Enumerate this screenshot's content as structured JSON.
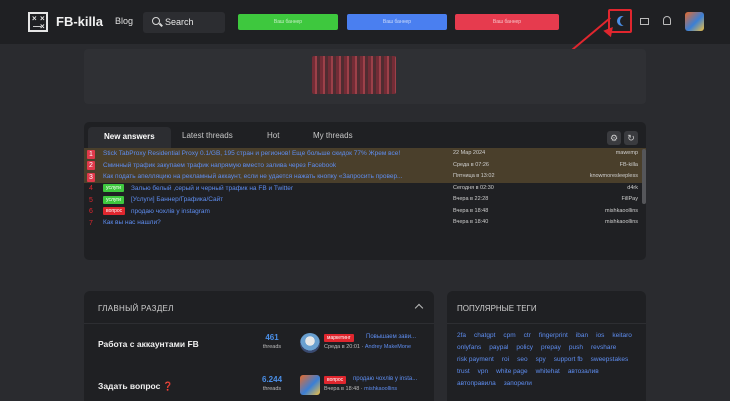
{
  "header": {
    "brand": "FB-killa",
    "nav_blog": "Blog",
    "search_label": "Search",
    "promos": [
      {
        "text": "Ваш баннер",
        "color": "#3ec83e"
      },
      {
        "text": "Ваш баннер",
        "color": "#4a7ff0"
      },
      {
        "text": "Ваш баннер",
        "color": "#e63b4e"
      }
    ],
    "icons": [
      "moon-icon",
      "mail-icon",
      "bell-icon"
    ]
  },
  "threads": {
    "tabs": [
      "New answers",
      "Latest threads",
      "Hot",
      "My threads"
    ],
    "rows": [
      {
        "num": "1",
        "tag": "",
        "title": "Stick TabProxy Residential Proxy 0.1/GB, 195 стран и регионов! Еще больше скидок 77% Жрем все!",
        "date": "22 Мар 2024",
        "author": "mawemp",
        "highlight": true
      },
      {
        "num": "2",
        "tag": "",
        "title": "Сминный трафик закупаем трафик напрямую вместо залива через Facebook",
        "date": "Среда в 07:26",
        "author": "FB-killa",
        "highlight": true
      },
      {
        "num": "3",
        "tag": "",
        "title": "Как подать апелляцию на рекламный аккаунт, если не удается нажать кнопку «Запросить провер...",
        "date": "Пятница в 13:02",
        "author": "knowmoresleepless",
        "highlight": true
      },
      {
        "num": "4",
        "tag": "услуги",
        "title": "Залью белый ,серый и черный трафик на FB и Twitter",
        "date": "Сегодня в 02:30",
        "author": "d4rk",
        "highlight": false
      },
      {
        "num": "5",
        "tag": "услуги",
        "title": "[Услуги] Баннер/Графика/Сайт",
        "date": "Вчера в 22:28",
        "author": "FillPay",
        "highlight": false
      },
      {
        "num": "6",
        "tag": "вопрос",
        "title": "продаю чохлів у instagram",
        "date": "Вчера в 18:48",
        "author": "mishkaoollins",
        "highlight": false
      },
      {
        "num": "7",
        "tag": "",
        "title": "Как вы нас нашли?",
        "date": "Вчера в 18:40",
        "author": "mishkaoollins",
        "highlight": false
      }
    ]
  },
  "main_section": {
    "title": "ГЛАВНЫЙ РАЗДЕЛ",
    "forums": [
      {
        "name": "Работа с аккаунтами FB",
        "count": "461",
        "count_label": "threads",
        "badge": "маркетинг",
        "last": "Повышаем зави...",
        "meta_date": "Среда в 20:01 · ",
        "meta_user": "Andrey MakeMone"
      },
      {
        "name": "Задать вопрос ❓",
        "count": "6.244",
        "count_label": "threads",
        "badge": "вопрос",
        "last": "продаю чохлів у insta...",
        "meta_date": "Вчера в 18:48 · ",
        "meta_user": "mishkaoollins"
      }
    ]
  },
  "tags": {
    "title": "ПОПУЛЯРНЫЕ ТЕГИ",
    "items": [
      "2fa",
      "chatgpt",
      "cpm",
      "ctr",
      "fingerprint",
      "iban",
      "ios",
      "keitaro",
      "onlyfans",
      "paypal",
      "policy",
      "prepay",
      "push",
      "revshare",
      "risk payment",
      "roi",
      "seo",
      "spy",
      "support fb",
      "sweepstakes",
      "trust",
      "vpn",
      "white page",
      "whitehat",
      "автозалив",
      "автоправила",
      "запорели"
    ]
  }
}
